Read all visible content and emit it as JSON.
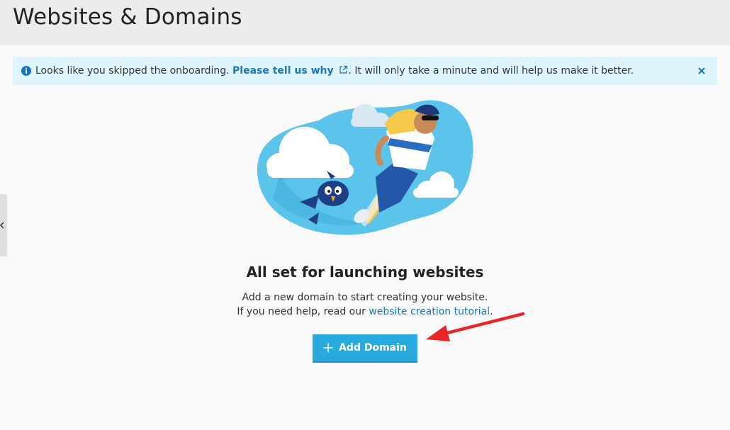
{
  "header": {
    "title": "Websites & Domains"
  },
  "banner": {
    "icon": "info-icon",
    "text_before": "Looks like you skipped the onboarding. ",
    "link_label": "Please tell us why",
    "link_icon": "external-link-icon",
    "text_after": ". It will only take a minute and will help us make it better.",
    "close_icon": "close-icon"
  },
  "empty_state": {
    "title": "All set for launching websites",
    "line1": "Add a new domain to start creating your website.",
    "line2_prefix": "If you need help, read our ",
    "line2_link": "website creation tutorial",
    "line2_suffix": "."
  },
  "actions": {
    "add_domain_label": "Add Domain",
    "add_icon": "plus-icon"
  },
  "colors": {
    "accent": "#28aade",
    "link": "#1a76ba",
    "banner_bg": "#def5fd",
    "annotation": "#e8262a"
  }
}
